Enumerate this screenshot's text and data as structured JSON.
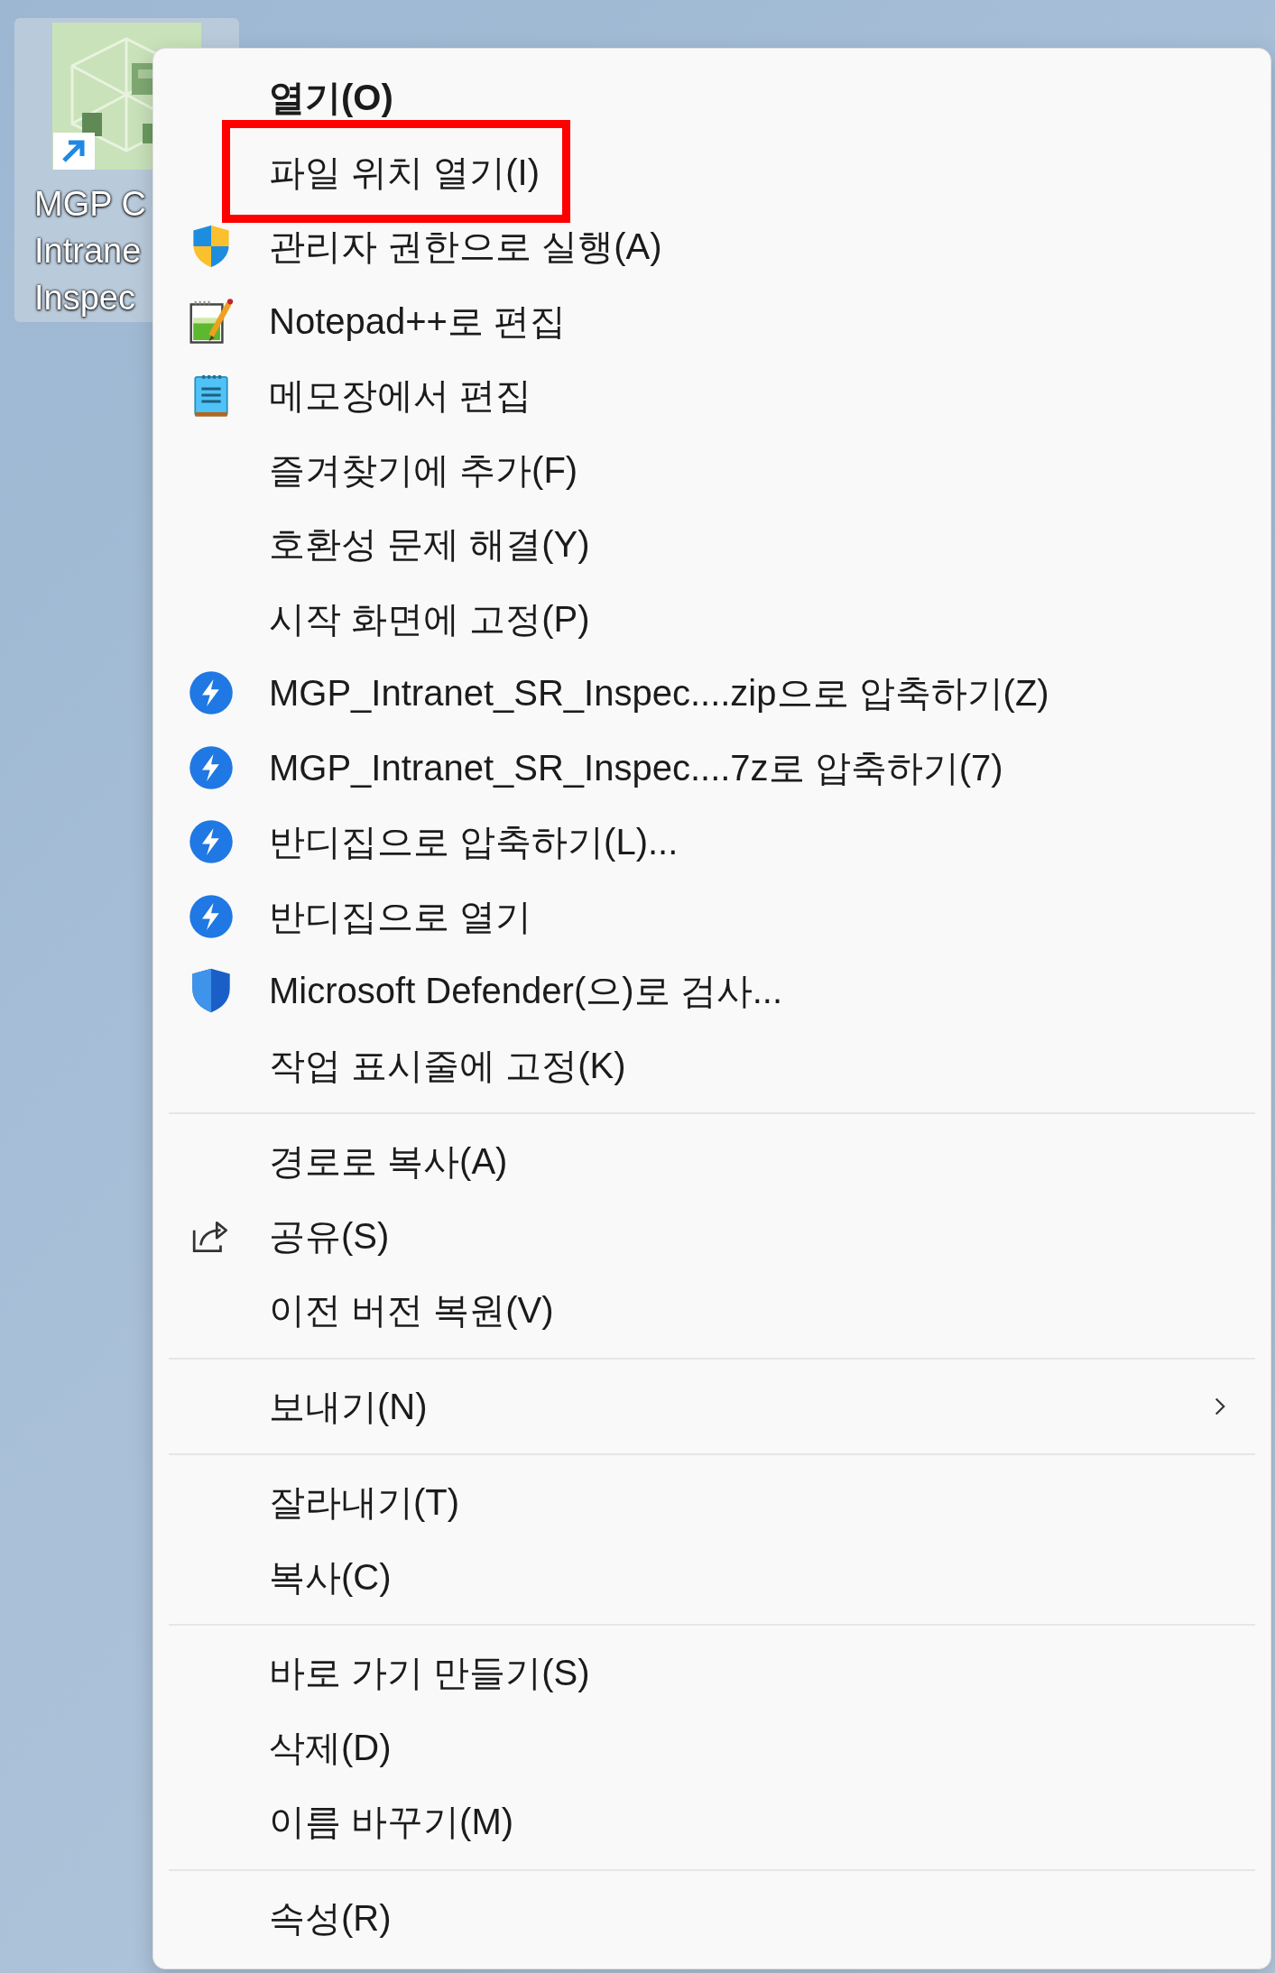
{
  "desktop_icon": {
    "selected": true,
    "label_lines": [
      "MGP C",
      "Intrane",
      "Inspec"
    ]
  },
  "context_menu": {
    "sections": [
      {
        "items": [
          {
            "label": "열기(O)",
            "kind": "plain",
            "default": true,
            "highlighted": false,
            "submenu": false
          },
          {
            "label": "파일 위치 열기(I)",
            "kind": "plain",
            "default": false,
            "highlighted": true,
            "submenu": false
          },
          {
            "label": "관리자 권한으로 실행(A)",
            "kind": "admin",
            "default": false,
            "highlighted": false,
            "submenu": false
          },
          {
            "label": "Notepad++로 편집",
            "kind": "editor",
            "default": false,
            "highlighted": false,
            "submenu": false
          },
          {
            "label": "메모장에서 편집",
            "kind": "notes",
            "default": false,
            "highlighted": false,
            "submenu": false
          },
          {
            "label": "즐겨찾기에 추가(F)",
            "kind": "plain",
            "default": false,
            "highlighted": false,
            "submenu": false
          },
          {
            "label": "호환성 문제 해결(Y)",
            "kind": "plain",
            "default": false,
            "highlighted": false,
            "submenu": false
          },
          {
            "label": "시작 화면에 고정(P)",
            "kind": "plain",
            "default": false,
            "highlighted": false,
            "submenu": false
          },
          {
            "label": "MGP_Intranet_SR_Inspec....zip으로 압축하기(Z)",
            "kind": "archive",
            "default": false,
            "highlighted": false,
            "submenu": false
          },
          {
            "label": "MGP_Intranet_SR_Inspec....7z로 압축하기(7)",
            "kind": "archive",
            "default": false,
            "highlighted": false,
            "submenu": false
          },
          {
            "label": "반디집으로 압축하기(L)...",
            "kind": "archive",
            "default": false,
            "highlighted": false,
            "submenu": false
          },
          {
            "label": "반디집으로 열기",
            "kind": "archive",
            "default": false,
            "highlighted": false,
            "submenu": false
          },
          {
            "label": "Microsoft Defender(으)로 검사...",
            "kind": "scan",
            "default": false,
            "highlighted": false,
            "submenu": false
          },
          {
            "label": "작업 표시줄에 고정(K)",
            "kind": "plain",
            "default": false,
            "highlighted": false,
            "submenu": false
          }
        ]
      },
      {
        "items": [
          {
            "label": "경로로 복사(A)",
            "kind": "plain",
            "default": false,
            "highlighted": false,
            "submenu": false
          },
          {
            "label": "공유(S)",
            "kind": "share",
            "default": false,
            "highlighted": false,
            "submenu": false
          },
          {
            "label": "이전 버전 복원(V)",
            "kind": "plain",
            "default": false,
            "highlighted": false,
            "submenu": false
          }
        ]
      },
      {
        "items": [
          {
            "label": "보내기(N)",
            "kind": "plain",
            "default": false,
            "highlighted": false,
            "submenu": true
          }
        ]
      },
      {
        "items": [
          {
            "label": "잘라내기(T)",
            "kind": "plain",
            "default": false,
            "highlighted": false,
            "submenu": false
          },
          {
            "label": "복사(C)",
            "kind": "plain",
            "default": false,
            "highlighted": false,
            "submenu": false
          }
        ]
      },
      {
        "items": [
          {
            "label": "바로 가기 만들기(S)",
            "kind": "plain",
            "default": false,
            "highlighted": false,
            "submenu": false
          },
          {
            "label": "삭제(D)",
            "kind": "plain",
            "default": false,
            "highlighted": false,
            "submenu": false
          },
          {
            "label": "이름 바꾸기(M)",
            "kind": "plain",
            "default": false,
            "highlighted": false,
            "submenu": false
          }
        ]
      },
      {
        "items": [
          {
            "label": "속성(R)",
            "kind": "plain",
            "default": false,
            "highlighted": false,
            "submenu": false
          }
        ]
      }
    ]
  }
}
